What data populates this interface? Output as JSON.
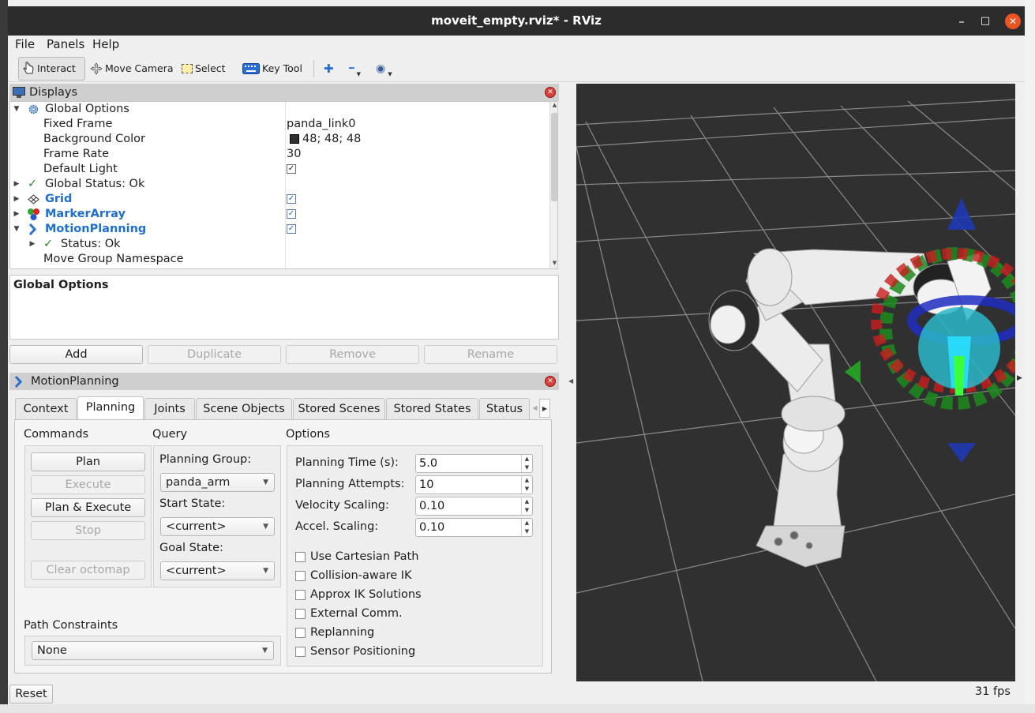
{
  "window": {
    "title": "moveit_empty.rviz* - RViz",
    "controls": [
      "–",
      "□",
      "✕"
    ]
  },
  "menu": {
    "file": "File",
    "panels": "Panels",
    "help": "Help"
  },
  "toolbar": {
    "interact": "Interact",
    "move_camera": "Move Camera",
    "select": "Select",
    "key_tool": "Key Tool",
    "add_icon": "✚",
    "remove_icon": "━",
    "eye_icon": "◉"
  },
  "displays": {
    "title": "Displays",
    "rows": {
      "global_options": "Global Options",
      "fixed_frame": "Fixed Frame",
      "fixed_frame_value": "panda_link0",
      "background_color": "Background Color",
      "background_color_value": "48; 48; 48",
      "frame_rate": "Frame Rate",
      "frame_rate_value": "30",
      "default_light": "Default Light",
      "global_status": "Global Status: Ok",
      "grid": "Grid",
      "marker_array": "MarkerArray",
      "motion_planning": "MotionPlanning",
      "status_ok": "Status: Ok",
      "move_group_namespace": "Move Group Namespace"
    },
    "description_title": "Global Options",
    "buttons": {
      "add": "Add",
      "duplicate": "Duplicate",
      "remove": "Remove",
      "rename": "Rename"
    }
  },
  "motion_planning": {
    "title": "MotionPlanning",
    "tabs": [
      "Context",
      "Planning",
      "Joints",
      "Scene Objects",
      "Stored Scenes",
      "Stored States",
      "Status"
    ],
    "commands": {
      "label": "Commands",
      "plan": "Plan",
      "execute": "Execute",
      "plan_execute": "Plan & Execute",
      "stop": "Stop",
      "clear_octomap": "Clear octomap"
    },
    "query": {
      "label": "Query",
      "planning_group_label": "Planning Group:",
      "planning_group": "panda_arm",
      "start_state_label": "Start State:",
      "start_state": "<current>",
      "goal_state_label": "Goal State:",
      "goal_state": "<current>"
    },
    "options": {
      "label": "Options",
      "planning_time_label": "Planning Time (s):",
      "planning_time": "5.0",
      "planning_attempts_label": "Planning Attempts:",
      "planning_attempts": "10",
      "velocity_scaling_label": "Velocity Scaling:",
      "velocity_scaling": "0.10",
      "accel_scaling_label": "Accel. Scaling:",
      "accel_scaling": "0.10",
      "checkboxes": [
        "Use Cartesian Path",
        "Collision-aware IK",
        "Approx IK Solutions",
        "External Comm.",
        "Replanning",
        "Sensor Positioning"
      ]
    },
    "path_constraints": {
      "label": "Path Constraints",
      "value": "None"
    }
  },
  "status": {
    "reset": "Reset",
    "fps": "31 fps"
  },
  "colors": {
    "viewport_bg": "#303030",
    "titlebar": "#2c2c2c",
    "close_accent": "#e95420",
    "link_blue": "#1e6fcf"
  }
}
